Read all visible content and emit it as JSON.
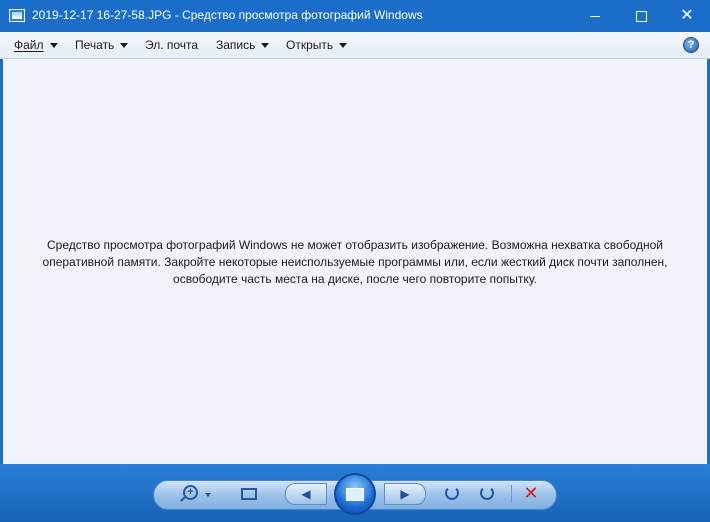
{
  "window": {
    "title": "2019-12-17 16-27-58.JPG - Средство просмотра фотографий Windows",
    "minimize_glyph": "",
    "maximize_glyph": "",
    "close_glyph": "✕"
  },
  "menu": {
    "items": [
      {
        "label": "Файл",
        "has_dropdown": true
      },
      {
        "label": "Печать",
        "has_dropdown": true
      },
      {
        "label": "Эл. почта",
        "has_dropdown": false
      },
      {
        "label": "Запись",
        "has_dropdown": true
      },
      {
        "label": "Открыть",
        "has_dropdown": true
      }
    ],
    "help_glyph": "?"
  },
  "content": {
    "message_lines": [
      "Средство просмотра фотографий Windows не может отобразить изображение. Возможна нехватка свободной",
      "оперативной памяти. Закройте некоторые неиспользуемые программы или, если жесткий диск почти заполнен,",
      "освободите часть места на диске, после чего повторите попытку."
    ]
  },
  "controls": {
    "zoom_glyph": "+",
    "prev_glyph": "◀",
    "next_glyph": "▶",
    "delete_glyph": "✕",
    "icons": [
      "zoom-icon",
      "actual-size-icon",
      "previous-icon",
      "slideshow-icon",
      "next-icon",
      "rotate-counterclockwise-icon",
      "rotate-clockwise-icon",
      "delete-icon"
    ]
  },
  "colors": {
    "titlebar": "#1a6ec9",
    "content_bg": "#f0f4fa",
    "bottombar": "#1f6fc4",
    "delete": "#d0201b"
  }
}
